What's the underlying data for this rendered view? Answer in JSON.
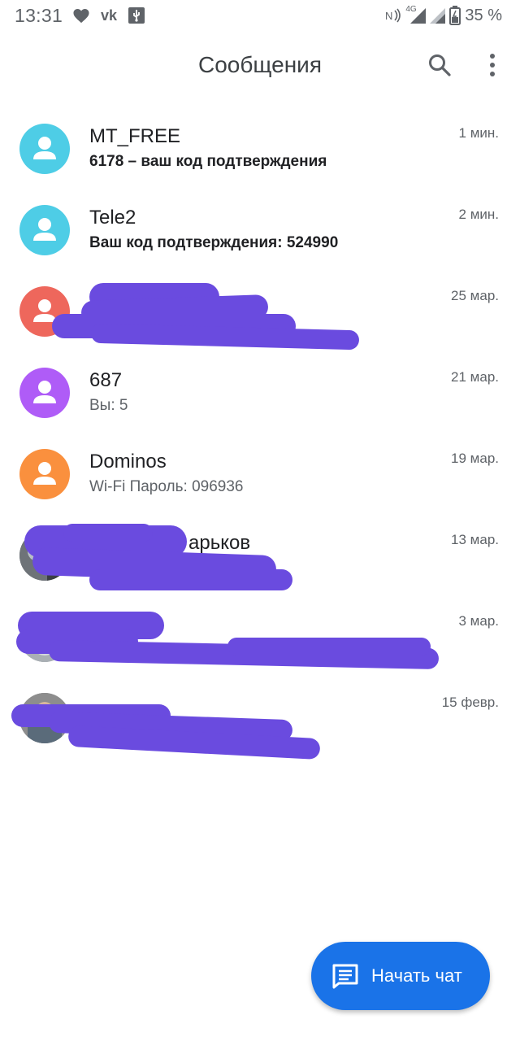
{
  "status_bar": {
    "time": "13:31",
    "battery": "35 %",
    "network_label": "4G",
    "icons": [
      "heart-icon",
      "vk-icon",
      "usb-icon",
      "nfc-icon",
      "signal-icon",
      "signal-icon",
      "battery-icon"
    ]
  },
  "app_bar": {
    "title": "Сообщения",
    "icons": [
      "search-icon",
      "more-vert-icon"
    ]
  },
  "conversations": [
    {
      "title": "MT_FREE",
      "snippet": "6178 – ваш код подтверждения",
      "time": "1 мин.",
      "unread": true,
      "avatar_color": "#4ecde6"
    },
    {
      "title": "Tele2",
      "snippet": "Ваш код подтверждения: 524990",
      "time": "2 мин.",
      "unread": true,
      "avatar_color": "#4ecde6"
    },
    {
      "title": "",
      "snippet": "",
      "time": "25 мар.",
      "unread": false,
      "avatar_color": "#ee675c",
      "redacted": true
    },
    {
      "title": "687",
      "snippet": "Вы: 5",
      "time": "21 мар.",
      "unread": false,
      "avatar_color": "#af5cf7"
    },
    {
      "title": "Dominos",
      "snippet": "Wi-Fi Пароль: 096936",
      "time": "19 мар.",
      "unread": false,
      "avatar_color": "#fa903e"
    },
    {
      "title": "арьков",
      "snippet": "",
      "time": "13 мар.",
      "unread": false,
      "avatar_color": "#9aa0a6",
      "redacted": true,
      "photo": true
    },
    {
      "title": "",
      "snippet": "",
      "time": "3 мар.",
      "unread": false,
      "avatar_color": "#9aa0a6",
      "redacted": true,
      "photo": true
    },
    {
      "title": "",
      "snippet": "",
      "time": "15 февр.",
      "unread": false,
      "avatar_color": "#8d8d8d",
      "redacted": true,
      "photo": true
    }
  ],
  "fab": {
    "label": "Начать чат",
    "icon": "chat-icon"
  },
  "colors": {
    "accent": "#1a73e8",
    "redaction": "#6a4bdf"
  }
}
